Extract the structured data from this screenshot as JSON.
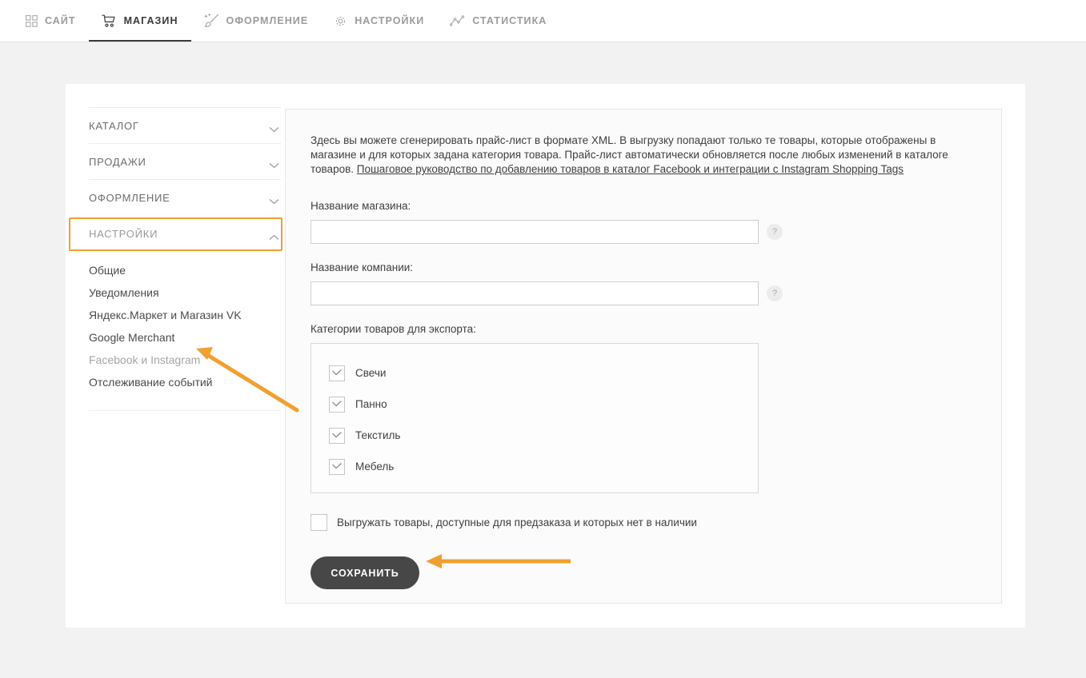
{
  "topnav": {
    "items": [
      {
        "label": "САЙТ",
        "icon": "grid-icon",
        "active": false
      },
      {
        "label": "МАГАЗИН",
        "icon": "cart-icon",
        "active": true
      },
      {
        "label": "ОФОРМЛЕНИЕ",
        "icon": "magic-brush-icon",
        "active": false
      },
      {
        "label": "НАСТРОЙКИ",
        "icon": "gear-icon",
        "active": false
      },
      {
        "label": "СТАТИСТИКА",
        "icon": "chart-line-icon",
        "active": false
      }
    ]
  },
  "sidebar": {
    "groups": [
      {
        "label": "КАТАЛОГ",
        "state": "collapsed"
      },
      {
        "label": "ПРОДАЖИ",
        "state": "collapsed"
      },
      {
        "label": "ОФОРМЛЕНИЕ",
        "state": "collapsed"
      },
      {
        "label": "НАСТРОЙКИ",
        "state": "expanded"
      }
    ],
    "subitems": [
      {
        "label": "Общие",
        "selected": false
      },
      {
        "label": "Уведомления",
        "selected": false
      },
      {
        "label": "Яндекс.Маркет и Магазин VK",
        "selected": false
      },
      {
        "label": "Google Merchant",
        "selected": false
      },
      {
        "label": "Facebook и Instagram",
        "selected": true
      },
      {
        "label": "Отслеживание событий",
        "selected": false
      }
    ]
  },
  "main": {
    "intro_part1": "Здесь вы можете сгенерировать прайс-лист в формате XML. В выгрузку попадают только те товары, которые отображены в магазине и для которых задана категория товара. Прайс-лист автоматически обновляется после любых изменений в каталоге товаров. ",
    "intro_link": "Пошаговое руководство по добавлению товаров в каталог Facebook и интеграции с Instagram Shopping Tags",
    "shop_name_label": "Название магазина:",
    "shop_name_value": "",
    "company_name_label": "Название компании:",
    "company_name_value": "",
    "help_glyph": "?",
    "categories_label": "Категории товаров для экспорта:",
    "categories": [
      {
        "label": "Свечи",
        "checked": true
      },
      {
        "label": "Панно",
        "checked": true
      },
      {
        "label": "Текстиль",
        "checked": true
      },
      {
        "label": "Мебель",
        "checked": true
      }
    ],
    "preorder_label": "Выгружать товары, доступные для предзаказа и которых нет в наличии",
    "preorder_checked": false,
    "save_label": "СОХРАНИТЬ"
  },
  "annotations": {
    "accent_color": "#f0a030",
    "highlight_target": "НАСТРОЙКИ",
    "arrow_targets": [
      "Facebook и Instagram",
      "СОХРАНИТЬ"
    ]
  }
}
